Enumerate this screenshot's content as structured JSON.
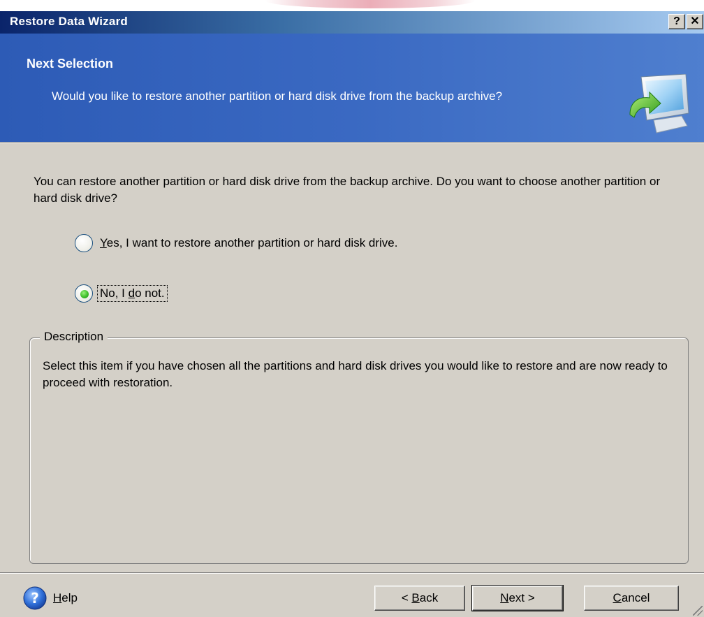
{
  "window": {
    "title": "Restore Data Wizard",
    "help_button": "?",
    "close_button": "✕"
  },
  "header": {
    "title": "Next Selection",
    "subtitle": "Would you like to restore another partition or hard disk drive from the backup archive?"
  },
  "content": {
    "prompt": "You can restore another partition or hard disk drive from the backup archive. Do you want to choose another partition or hard disk drive?",
    "options": [
      {
        "label_prefix": "",
        "label_underlined": "Y",
        "label_rest": "es, I want to restore another partition or hard disk drive.",
        "checked": false
      },
      {
        "label_prefix": "No, I ",
        "label_underlined": "d",
        "label_rest": "o not.",
        "checked": true
      }
    ]
  },
  "description": {
    "legend": "Description",
    "text": "Select this item if you have chosen all the partitions and hard disk drives you would like to restore and are now ready to proceed with restoration."
  },
  "footer": {
    "help_label_underlined": "H",
    "help_label_rest": "elp",
    "back_prefix": "< ",
    "back_underlined": "B",
    "back_rest": "ack",
    "next_underlined": "N",
    "next_rest": "ext >",
    "cancel_underlined": "C",
    "cancel_rest": "ancel"
  },
  "colors": {
    "title_bar_start": "#0a246a",
    "title_bar_end": "#a6caf0",
    "header_bg": "#3a69c2",
    "window_bg": "#d4d0c8",
    "radio_checked": "#3fbf2a"
  },
  "icons": {
    "header": "computer-restore-icon",
    "help": "help-icon"
  }
}
